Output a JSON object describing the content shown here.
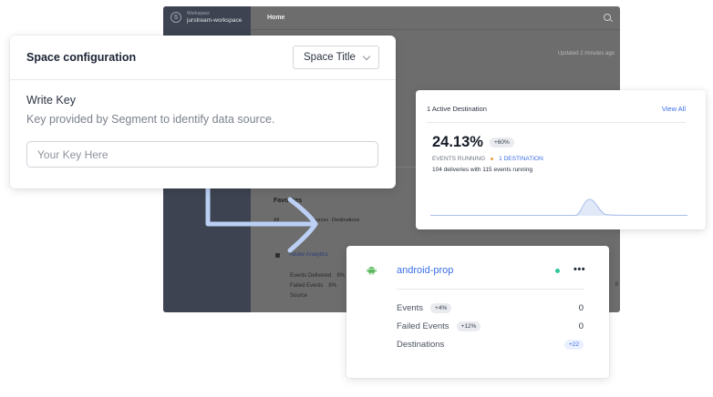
{
  "app": {
    "workspace_label": "Workspace",
    "workspace_name": "jurstream-workspace",
    "home": "Home",
    "updated": "Updated 2 minutes ago",
    "favorites_title": "Favorites",
    "favorites_tabs": [
      "All",
      "Sources",
      "Destinations"
    ],
    "favorite_item": "Adobe Analytics",
    "favorite_rows": [
      {
        "label": "Events Delivered",
        "value": "8%"
      },
      {
        "label": "Failed Events",
        "value": "8%"
      },
      {
        "label": "Source",
        "value": ""
      }
    ],
    "right_digit": "0"
  },
  "space_config": {
    "title": "Space configuration",
    "select_value": "Space Title",
    "write_key_label": "Write Key",
    "write_key_desc": "Key provided by Segment to identify data source.",
    "input_placeholder": "Your Key Here",
    "input_value": ""
  },
  "destination": {
    "header": "1 Active Destination",
    "view_all": "View All",
    "percent": "24.13%",
    "percent_change": "+60%",
    "events_running": "EVENTS RUNNING",
    "destination_count": "1 DESTINATION",
    "deliveries": "104 deliveries with 115 events running",
    "line_color": "#a8bfe8",
    "fill_color": "#e1e9f8"
  },
  "android": {
    "name": "android-prop",
    "status_color": "#2ec79a",
    "more": "•••",
    "rows": [
      {
        "label": "Events",
        "badge": "+4%",
        "value": "0"
      },
      {
        "label": "Failed Events",
        "badge": "+12%",
        "value": "0"
      },
      {
        "label": "Destinations",
        "badge": "",
        "value": "+22"
      }
    ]
  },
  "colors": {
    "accent": "#3b6ee8",
    "arrow": "#bcd0f5"
  }
}
